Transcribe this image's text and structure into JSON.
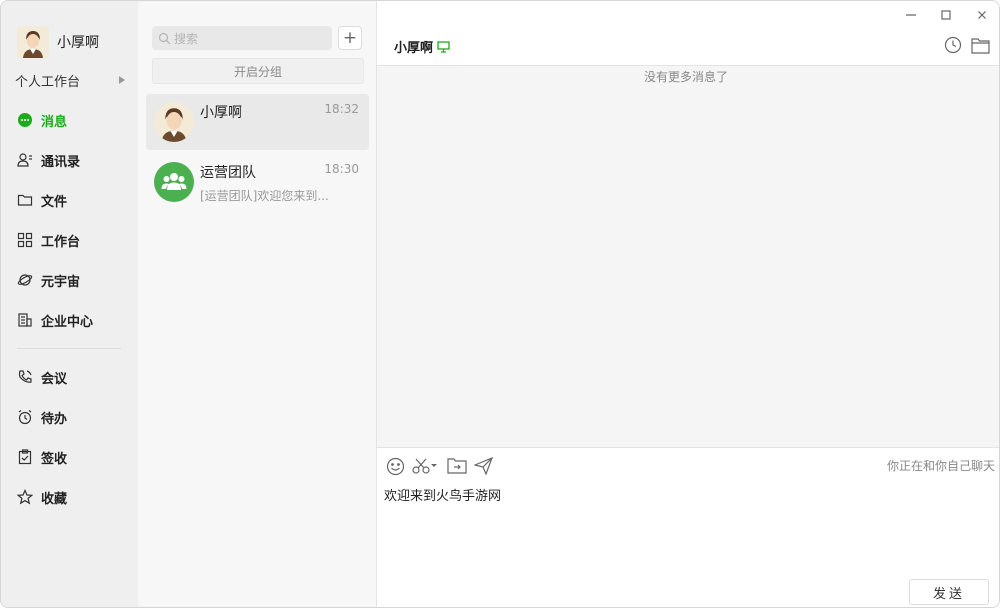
{
  "sidebar": {
    "profile_name": "小厚啊",
    "workspace_label": "个人工作台",
    "nav": [
      {
        "label": "消息",
        "icon": "chat-bubble-icon",
        "active": true
      },
      {
        "label": "通讯录",
        "icon": "contacts-icon"
      },
      {
        "label": "文件",
        "icon": "folder-icon"
      },
      {
        "label": "工作台",
        "icon": "grid-icon"
      },
      {
        "label": "元宇宙",
        "icon": "planet-icon"
      },
      {
        "label": "企业中心",
        "icon": "building-icon"
      },
      {
        "label": "会议",
        "icon": "phone-icon"
      },
      {
        "label": "待办",
        "icon": "alarm-clock-icon"
      },
      {
        "label": "签收",
        "icon": "clipboard-check-icon"
      },
      {
        "label": "收藏",
        "icon": "star-icon"
      }
    ]
  },
  "conversations": {
    "search_placeholder": "搜索",
    "add_label": "+",
    "group_toggle_label": "开启分组",
    "items": [
      {
        "name": "小厚啊",
        "time": "18:32",
        "preview": ""
      },
      {
        "name": "运营团队",
        "time": "18:30",
        "preview": "[运营团队]欢迎您来到..."
      }
    ]
  },
  "chat": {
    "title": "小厚啊",
    "no_more_messages": "没有更多消息了",
    "talking_to_self": "你正在和你自己聊天",
    "draft_text": "欢迎来到火鸟手游网",
    "send_label": "发送"
  },
  "window_controls": {
    "minimize": "—",
    "maximize": "☐",
    "close": "✕"
  },
  "colors": {
    "accent": "#1aad19",
    "group_avatar": "#4caf50"
  }
}
